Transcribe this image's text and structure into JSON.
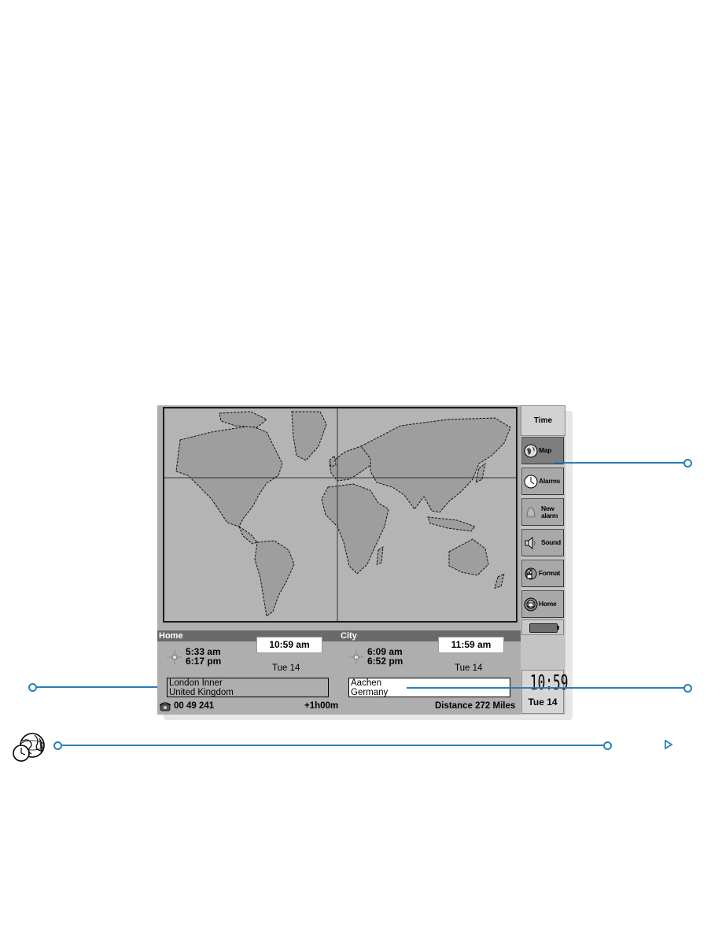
{
  "app": {
    "title": "Time",
    "view": "World map"
  },
  "sidebar": {
    "title": "Time",
    "buttons": [
      {
        "label": "Map",
        "icon": "globe-icon",
        "active": true
      },
      {
        "label": "Alarms",
        "icon": "clock-icon",
        "active": false
      },
      {
        "label": "New alarm",
        "label_line1": "New",
        "label_line2": "alarm",
        "icon": "bell-icon",
        "active": false
      },
      {
        "label": "Sound",
        "icon": "speaker-icon",
        "active": false
      },
      {
        "label": "Format",
        "icon": "format-icon",
        "active": false
      },
      {
        "label": "Home",
        "icon": "home-globe-icon",
        "active": false
      }
    ],
    "battery": {
      "icon": "battery-icon"
    },
    "clock": {
      "time": "10:59",
      "date": "Tue 14"
    }
  },
  "home": {
    "header": "Home",
    "time": "10:59 am",
    "sunrise": "5:33 am",
    "sunset": "6:17 pm",
    "date": "Tue  14",
    "city": "London Inner",
    "country": "United Kingdom",
    "dial_code": "00 49 241",
    "offset": "+1h00m"
  },
  "city": {
    "header": "City",
    "time": "11:59 am",
    "sunrise": "6:09 am",
    "sunset": "6:52 pm",
    "date": "Tue  14",
    "city": "Aachen",
    "country": "Germany",
    "distance": "Distance 272 Miles"
  },
  "colors": {
    "callout": "#2a7fb5",
    "screen_bg": "#aeaeae",
    "ocean": "#b4b4b4",
    "land": "#9e9e9e",
    "header_bar": "#6a6a6a"
  }
}
